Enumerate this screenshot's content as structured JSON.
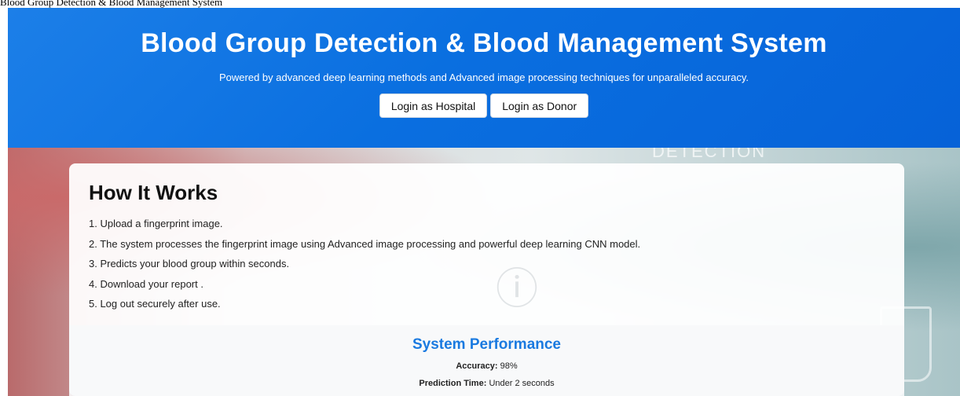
{
  "caption": "Blood Group Detection & Blood Management System",
  "header": {
    "title": "Blood Group Detection & Blood Management System",
    "subtitle": "Powered by advanced deep learning methods and Advanced image processing techniques for unparalleled accuracy.",
    "buttons": {
      "hospital": "Login as Hospital",
      "donor": "Login as Donor"
    }
  },
  "background": {
    "text": "DETECTION"
  },
  "how_it_works": {
    "heading": "How It Works",
    "steps": [
      "1. Upload a fingerprint image.",
      "2. The system processes the fingerprint image using Advanced image processing and powerful deep learning CNN model.",
      "3. Predicts your blood group within seconds.",
      "4. Download your report .",
      "5. Log out securely after use."
    ]
  },
  "performance": {
    "heading": "System Performance",
    "accuracy_label": "Accuracy:",
    "accuracy_value": "98%",
    "time_label": "Prediction Time:",
    "time_value": "Under 2 seconds"
  },
  "colors": {
    "header_blue": "#0a6fe0",
    "accent_blue": "#1a7ae0"
  }
}
